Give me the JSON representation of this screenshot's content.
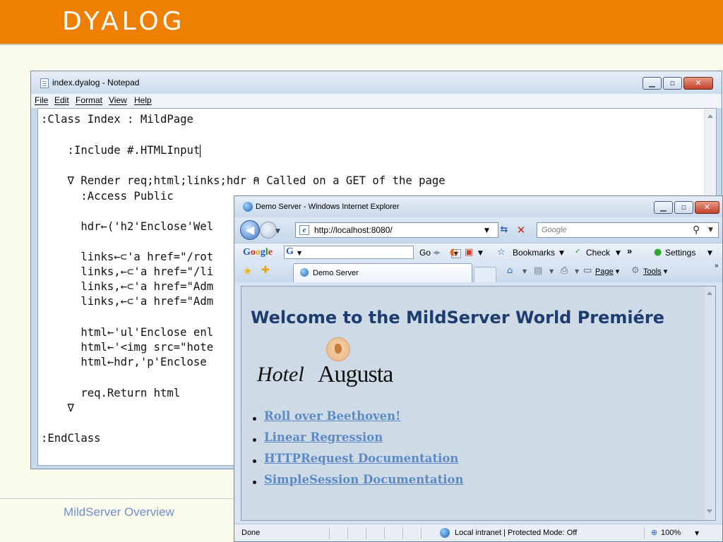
{
  "slide": {
    "logo": "DYALOG",
    "footer": "MildServer Overview",
    "colors": {
      "header_orange": "#ee7f00",
      "footer_text": "#6e8fcf"
    }
  },
  "notepad": {
    "title": "index.dyalog - Notepad",
    "menu": [
      "File",
      "Edit",
      "Format",
      "View",
      "Help"
    ],
    "code_lines": [
      ":Class Index : MildPage",
      "    :Include #.HTMLInput",
      "    ∇ Render req;html;links;hdr ⍝ Called on a GET of the page",
      "      :Access Public",
      "      hdr←('h2'Enclose'Wel",
      "      links←⊂'a href=\"/rot",
      "      links,←⊂'a href=\"/li",
      "      links,←⊂'a href=\"Adm",
      "      links,←⊂'a href=\"Adm",
      "      html←'ul'Enclose enl",
      "      html←'<img src=\"hote",
      "      html←hdr,'p'Enclose",
      "      req.Return html",
      "    ∇",
      ":EndClass"
    ]
  },
  "ie": {
    "title": "Demo Server - Windows Internet Explorer",
    "address": "http://localhost:8080/",
    "search_placeholder": "Google",
    "google_bar": {
      "go": "Go",
      "bookmarks": "Bookmarks",
      "check": "Check",
      "more": "»",
      "settings": "Settings"
    },
    "tab_label": "Demo Server",
    "toolbar": {
      "page": "Page",
      "tools": "Tools",
      "more": "»"
    },
    "content": {
      "heading": "Welcome to the MildServer World Premiére",
      "hotel_script": "Hotel",
      "hotel_caps": "Augusta",
      "links": [
        "Roll over Beethoven!",
        "Linear Regression",
        "HTTPRequest Documentation",
        "SimpleSession Documentation"
      ]
    },
    "status": {
      "text": "Done",
      "zone": "Local intranet | Protected Mode: Off",
      "zoom": "100%"
    }
  }
}
